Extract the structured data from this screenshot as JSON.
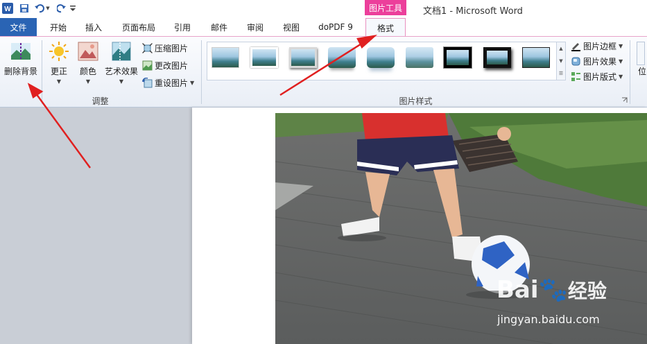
{
  "title_bar": {
    "context_tab": "图片工具",
    "window_title": "文档1 - Microsoft Word"
  },
  "tabs": [
    "文件",
    "开始",
    "插入",
    "页面布局",
    "引用",
    "邮件",
    "审阅",
    "视图",
    "doPDF 9",
    "格式"
  ],
  "ribbon": {
    "adjust_group": {
      "label": "调整",
      "remove_background": "删除背景",
      "corrections": "更正",
      "color": "颜色",
      "artistic_effects": "艺术效果",
      "compress_pictures": "压缩图片",
      "change_picture": "更改图片",
      "reset_picture": "重设图片"
    },
    "styles_group": {
      "label": "图片样式",
      "picture_border": "图片边框",
      "picture_effects": "图片效果",
      "picture_layout": "图片版式"
    },
    "next_group_partial": "位"
  },
  "watermark": {
    "brand": "Bai",
    "brand_suffix": "经验",
    "url": "jingyan.baidu.com"
  },
  "colors": {
    "file_tab": "#2a64b4",
    "context_tab": "#ec3f9b",
    "annotation_arrow": "#e02020"
  }
}
